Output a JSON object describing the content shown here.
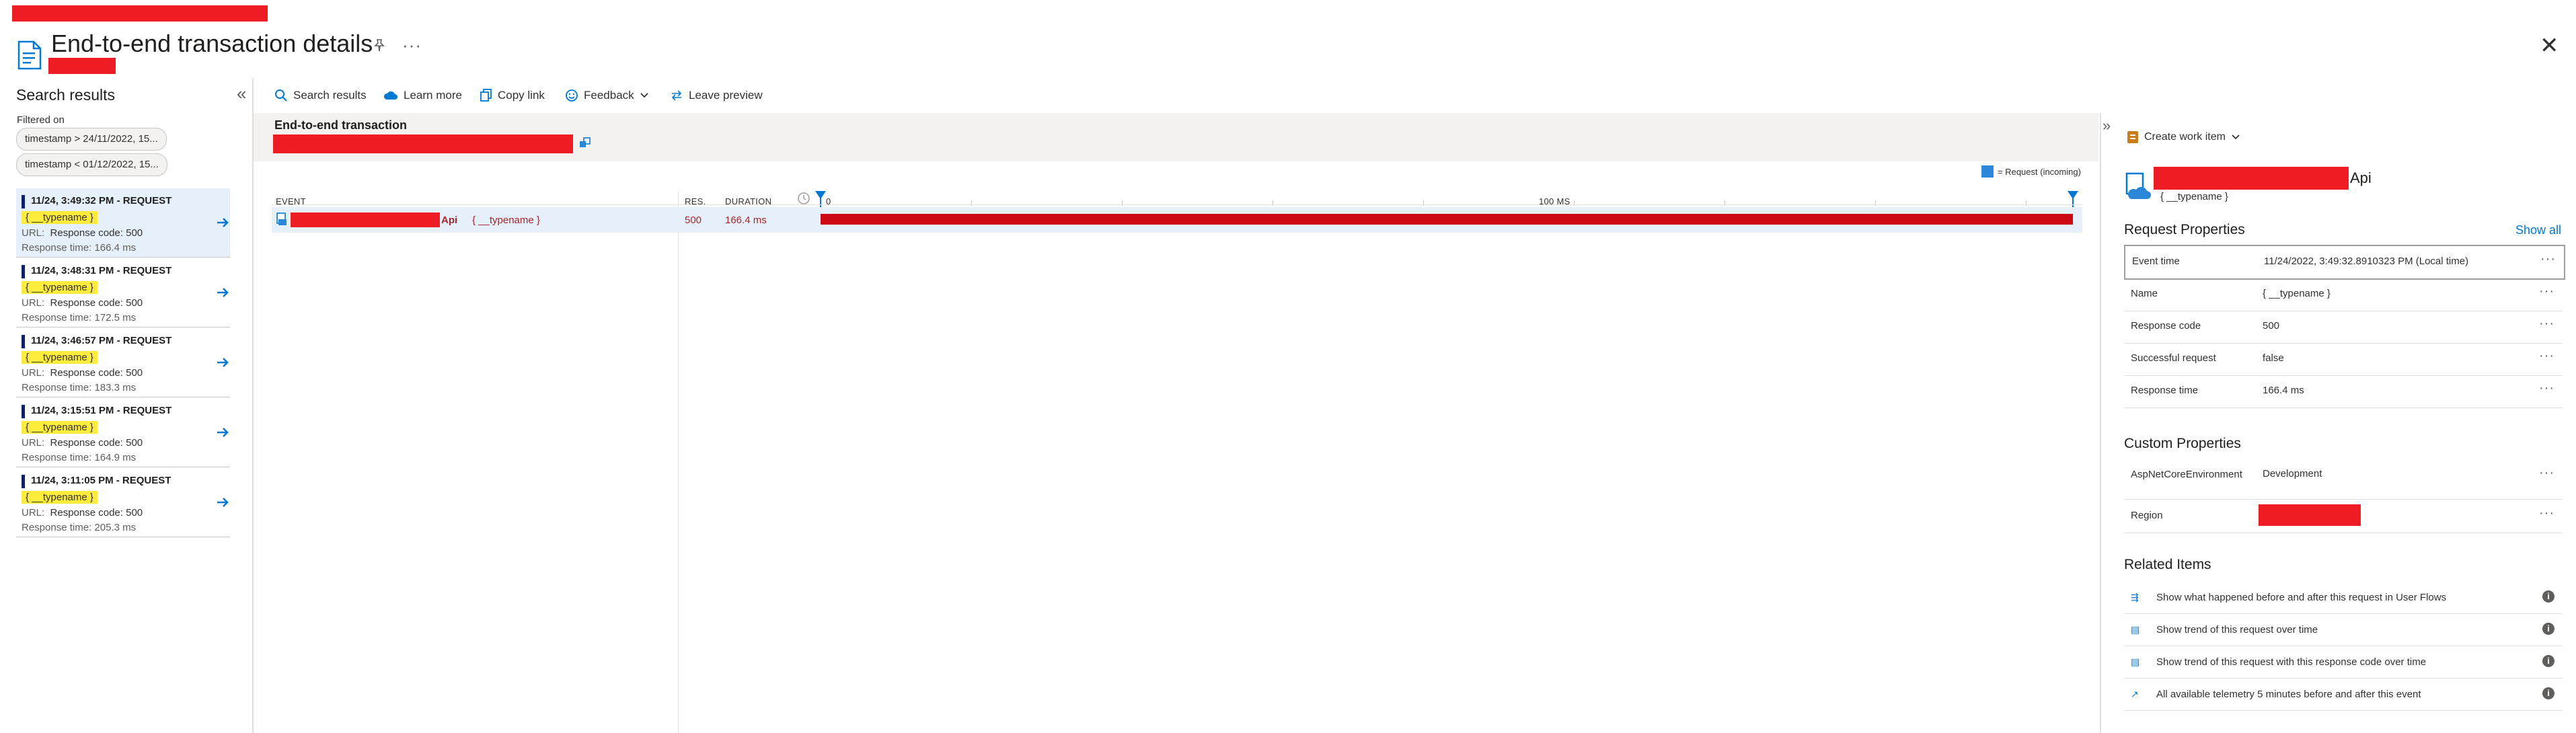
{
  "header": {
    "title": "End-to-end transaction details",
    "more": "···",
    "close": "✕"
  },
  "left": {
    "title": "Search results",
    "collapse": "«",
    "filtered_on": "Filtered on",
    "filters": [
      "timestamp > 24/11/2022, 15...",
      "timestamp < 01/12/2022, 15..."
    ],
    "results": [
      {
        "title": "11/24, 3:49:32 PM - REQUEST",
        "tag": "{ __typename }",
        "url_label": "URL:",
        "response_code": "Response code: 500",
        "response_time": "Response time: 166.4 ms"
      },
      {
        "title": "11/24, 3:48:31 PM - REQUEST",
        "tag": "{ __typename }",
        "url_label": "URL:",
        "response_code": "Response code: 500",
        "response_time": "Response time: 172.5 ms"
      },
      {
        "title": "11/24, 3:46:57 PM - REQUEST",
        "tag": "{ __typename }",
        "url_label": "URL:",
        "response_code": "Response code: 500",
        "response_time": "Response time: 183.3 ms"
      },
      {
        "title": "11/24, 3:15:51 PM - REQUEST",
        "tag": "{ __typename }",
        "url_label": "URL:",
        "response_code": "Response code: 500",
        "response_time": "Response time: 164.9 ms"
      },
      {
        "title": "11/24, 3:11:05 PM - REQUEST",
        "tag": "{ __typename }",
        "url_label": "URL:",
        "response_code": "Response code: 500",
        "response_time": "Response time: 205.3 ms"
      }
    ]
  },
  "toolbar": {
    "search_results": "Search results",
    "learn_more": "Learn more",
    "copy_link": "Copy link",
    "feedback": "Feedback",
    "leave_preview": "Leave preview"
  },
  "transaction": {
    "title": "End-to-end transaction",
    "legend": "= Request (incoming)",
    "columns": {
      "event": "EVENT",
      "res": "RES.",
      "duration": "DURATION"
    },
    "axis": {
      "start": "0",
      "mid": "100 MS"
    },
    "row": {
      "name_suffix": "Api",
      "operation": "{ __typename }",
      "res": "500",
      "duration": "166.4 ms"
    }
  },
  "details": {
    "create_work_item": "Create work item",
    "item_name_suffix": "Api",
    "item_subtitle": "{ __typename }",
    "request_properties_title": "Request Properties",
    "show_all": "Show all",
    "request_properties": [
      {
        "key": "Event time",
        "value": "11/24/2022, 3:49:32.8910323 PM (Local time)"
      },
      {
        "key": "Name",
        "value": "{ __typename }"
      },
      {
        "key": "Response code",
        "value": "500"
      },
      {
        "key": "Successful request",
        "value": "false"
      },
      {
        "key": "Response time",
        "value": "166.4 ms"
      }
    ],
    "custom_properties_title": "Custom Properties",
    "custom_properties": [
      {
        "key": "AspNetCoreEnvironment",
        "value": "Development"
      },
      {
        "key": "Region",
        "value": ""
      }
    ],
    "related_items_title": "Related Items",
    "related_items": [
      "Show what happened before and after this request in User Flows",
      "Show trend of this request over time",
      "Show trend of this request with this response code over time",
      "All available telemetry 5 minutes before and after this event"
    ]
  },
  "colors": {
    "accent": "#0078d4",
    "error_bar": "#cc0a16",
    "redaction": "#ee1c25",
    "highlight": "#ffeb3b",
    "selection": "#e6f0fb"
  }
}
